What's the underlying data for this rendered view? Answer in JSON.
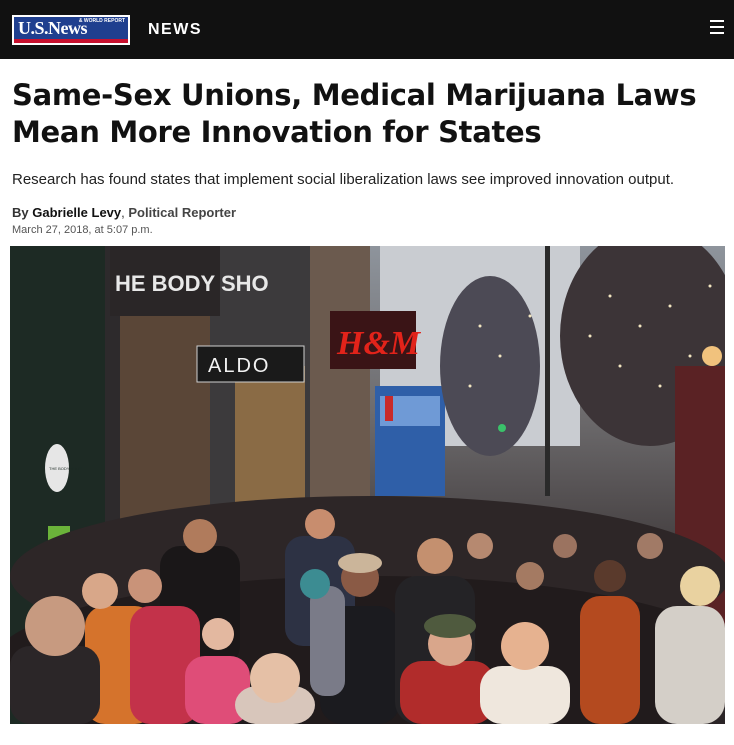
{
  "header": {
    "logo_text": "U.S.News",
    "logo_subtext": "& WORLD REPORT",
    "section": "NEWS",
    "menu_icon": "hamburger-menu-icon"
  },
  "article": {
    "headline": "Same-Sex Unions, Medical Marijuana Laws Mean More Innovation for States",
    "dek": "Research has found states that implement social liberalization laws see improved innovation output.",
    "byline": {
      "prefix": "By",
      "author": "Gabrielle Levy",
      "separator": ",",
      "role": "Political Reporter"
    },
    "date": "March 27, 2018, at 5:07 p.m."
  },
  "photo": {
    "store_sign_aldo": "ALDO",
    "store_sign_hm": "H&M",
    "store_sign_body_shop": "THE BODY SHOP",
    "store_sign_top_left": "HE BODY SHO"
  },
  "colors": {
    "topbar": "#111111",
    "logo_blue": "#1f3f8f",
    "logo_red": "#c8102e"
  }
}
